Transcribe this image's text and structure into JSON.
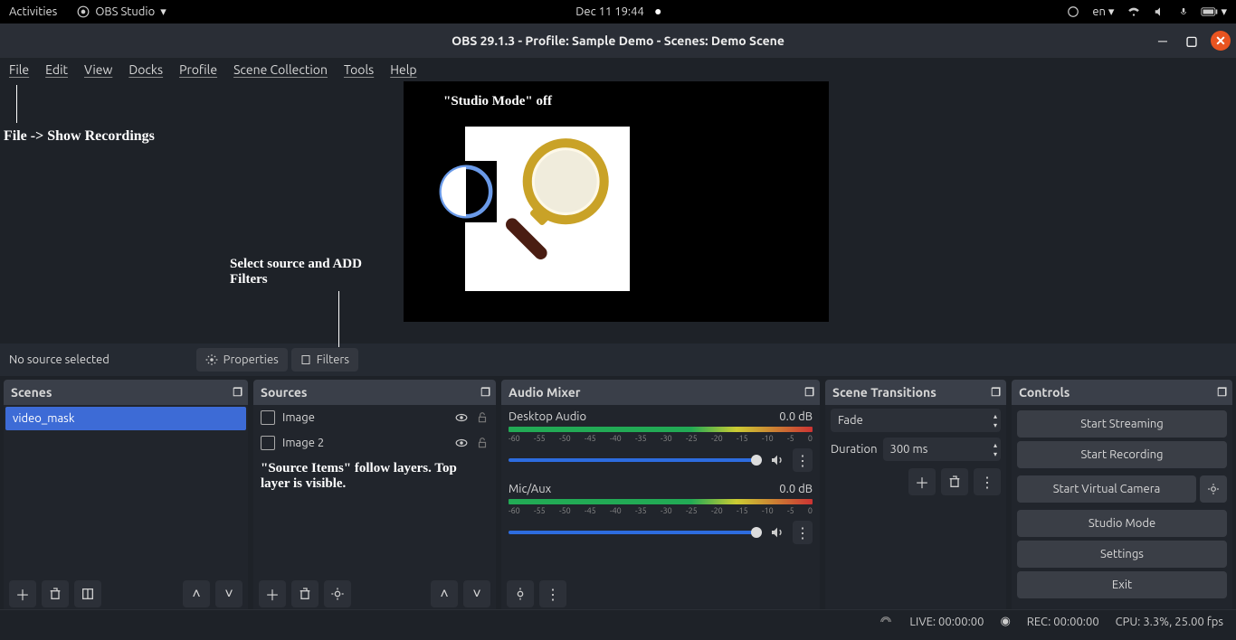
{
  "gnome": {
    "activities": "Activities",
    "appname": "OBS Studio",
    "datetime": "Dec 11  19:44",
    "lang": "en"
  },
  "window": {
    "title": "OBS 29.1.3 - Profile: Sample Demo - Scenes: Demo Scene"
  },
  "menubar": [
    "File",
    "Edit",
    "View",
    "Docks",
    "Profile",
    "Scene Collection",
    "Tools",
    "Help"
  ],
  "annotations": {
    "studio_off": "\"Studio Mode\" off",
    "show_recordings": "File -> Show Recordings",
    "add_filters": "Select source and ADD Filters",
    "source_layers": "\"Source Items\" follow layers. Top layer is visible."
  },
  "nosource": {
    "label": "No source selected",
    "properties": "Properties",
    "filters": "Filters"
  },
  "scenes": {
    "title": "Scenes",
    "items": [
      "video_mask"
    ]
  },
  "sources": {
    "title": "Sources",
    "items": [
      {
        "name": "Image"
      },
      {
        "name": "Image 2"
      }
    ]
  },
  "mixer": {
    "title": "Audio Mixer",
    "channels": [
      {
        "name": "Desktop Audio",
        "level": "0.0 dB"
      },
      {
        "name": "Mic/Aux",
        "level": "0.0 dB"
      }
    ],
    "scale": [
      "-60",
      "-55",
      "-50",
      "-45",
      "-40",
      "-35",
      "-30",
      "-25",
      "-20",
      "-15",
      "-10",
      "-5",
      "0"
    ]
  },
  "transitions": {
    "title": "Scene Transitions",
    "current": "Fade",
    "duration_label": "Duration",
    "duration_value": "300 ms"
  },
  "controls": {
    "title": "Controls",
    "buttons": [
      "Start Streaming",
      "Start Recording",
      "Start Virtual Camera",
      "Studio Mode",
      "Settings",
      "Exit"
    ]
  },
  "status": {
    "live": "LIVE: 00:00:00",
    "rec": "REC: 00:00:00",
    "cpu": "CPU: 3.3%, 25.00 fps"
  }
}
